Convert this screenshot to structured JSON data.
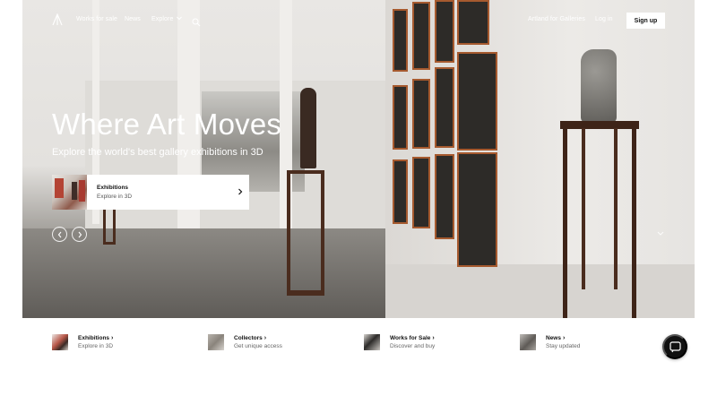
{
  "nav": {
    "logo_icon": "artland-logo-icon",
    "links": [
      "Works for sale",
      "News",
      "Explore"
    ],
    "search_icon": "search-icon",
    "galleries_link": "Artland for Galleries",
    "login": "Log in",
    "signup": "Sign up"
  },
  "hero": {
    "title": "Where Art Moves",
    "subtitle": "Explore the world's best gallery exhibitions in 3D",
    "card": {
      "title": "Exhibitions",
      "caption": "Explore in 3D"
    },
    "prev_icon": "chevron-left-icon",
    "next_icon": "chevron-right-icon",
    "scroll_icon": "chevron-down-icon"
  },
  "features": [
    {
      "title": "Exhibitions",
      "caption": "Explore in 3D"
    },
    {
      "title": "Collectors",
      "caption": "Get unique access"
    },
    {
      "title": "Works for Sale",
      "caption": "Discover and buy"
    },
    {
      "title": "News",
      "caption": "Stay updated"
    }
  ],
  "chat_icon": "chat-icon",
  "colors": {
    "accent": "#111111",
    "hero_text": "#ffffff",
    "frame_brown": "#a65a2f"
  }
}
